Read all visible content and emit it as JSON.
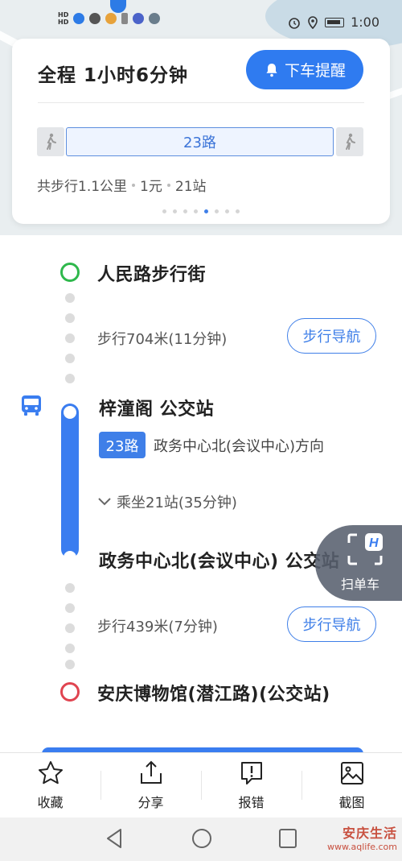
{
  "status_bar": {
    "time": "1:00",
    "left_icons": [
      "hd-signal-icon",
      "hd-signal-icon",
      "map-app-icon",
      "browser-icon",
      "photos-icon",
      "usb-icon",
      "p-icon",
      "telegram-icon"
    ],
    "right_icons": [
      "alarm-icon",
      "location-icon",
      "battery-icon"
    ]
  },
  "summary": {
    "title": "全程  1小时6分钟",
    "alert_button": "下车提醒",
    "route_segment": "23路",
    "walk_total": "共步行1.1公里",
    "fare": "1元",
    "stops": "21站",
    "page_count": 8,
    "active_page": 5
  },
  "route": {
    "origin": "人民路步行街",
    "walk1": "步行704米(11分钟)",
    "walk_nav_label": "步行导航",
    "board_stop": "梓潼阁 公交站",
    "line": "23路",
    "direction": "政务中心北(会议中心)方向",
    "ride_info": "乘坐21站(35分钟)",
    "alight_stop": "政务中心北(会议中心) 公交站",
    "walk2": "步行439米(7分钟)",
    "destination": "安庆博物馆(潜江路)(公交站)"
  },
  "scan_button": {
    "label": "扫单车"
  },
  "toolbar": {
    "favorite": "收藏",
    "share": "分享",
    "report": "报错",
    "screenshot": "截图"
  },
  "watermark": {
    "line1": "安庆生活",
    "line2": "www.aqlife.com"
  },
  "colors": {
    "accent": "#3f7fe8",
    "start": "#2fb84c",
    "end": "#e04450",
    "bus_line": "#3a7df0"
  }
}
